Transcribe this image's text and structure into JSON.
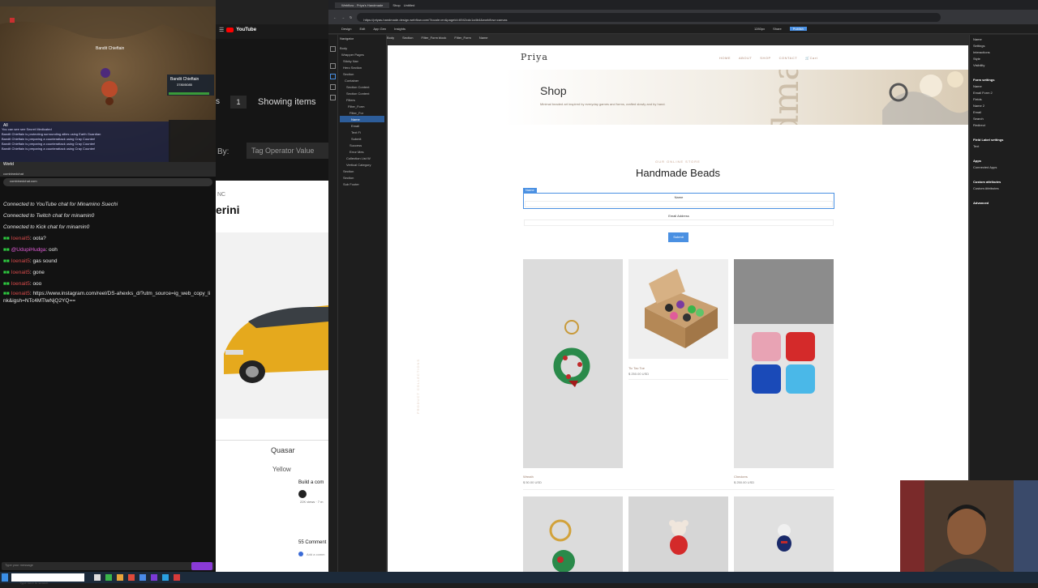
{
  "game": {
    "npc_name": "Bandit Chieftain",
    "target_name": "Bandit Chieftain",
    "target_hp": "3780/5085",
    "chat_lines": [
      "You can see see Secret Medicated",
      "Bandit Chieftain is protecting surrounding allies using Earth Guardian",
      "Bandit Chieftain is preparing a counterattack using Cray Counter!",
      "Bandit Chieftain is preparing a counterattack using Cray Counter!",
      "Bandit Chieftain is preparing a counterattack using Cray Counter!"
    ],
    "tabs": [
      "All",
      "World"
    ]
  },
  "chat": {
    "tab_label": "combinedchat",
    "address": "combinedchat.com",
    "connected": [
      "Connected to YouTube chat for Minamino Suechi",
      "Connected to Twitch chat for minamin0",
      "Connected to Kick chat for minamin0"
    ],
    "messages": [
      {
        "user": "Ioenait5",
        "text": "oota?"
      },
      {
        "user": "@UdupiHudga",
        "text": "ooh"
      },
      {
        "user": "Ioenait5",
        "text": "gas sound"
      },
      {
        "user": "Ioenait5",
        "text": "gone"
      },
      {
        "user": "Ioenait5",
        "text": "ooo"
      },
      {
        "user": "Ioenait5",
        "text": "https://www.instagram.com/reel/DS-ahexks_d/?utm_source=ig_web_copy_link&igsh=NTc4MTlwNjQ2YQ=="
      }
    ],
    "username_color": "#d44a4a",
    "input_placeholder": "Type your message"
  },
  "yt": {
    "logo": "YouTube",
    "count": "1",
    "showing": "Showing items",
    "by": "By:",
    "tag_op": "Tag Operator Value",
    "nc": "NC",
    "brand": "erini",
    "quasar": "Quasar",
    "yellow": "Yellow",
    "build": "Build a com",
    "comments": "55 Comment",
    "add": "Add a comm",
    "views": "22K views · 7 m"
  },
  "browser": {
    "tabs": [
      "Webflow - Priya's Handmade",
      "Shop",
      "Untitled"
    ],
    "url": "https://priyas-handmade.design.webflow.com/?locale=en&pageId=6942cdc1a4b4&workflow=canvas"
  },
  "webflow": {
    "topbar": {
      "design": "Design",
      "edit": "Edit",
      "app_gen": "App Gen",
      "insights": "Insights",
      "breakpoint": "1280px",
      "share": "Share",
      "publish": "Publish"
    },
    "breadcrumb": [
      "Body",
      "Section",
      "Filter_Form block",
      "Filter_Form",
      "Name"
    ],
    "navigator_title": "Navigator",
    "navigator_items": [
      "Body",
      "Wrapper Pages",
      "Sticky Nav",
      "Hero Section",
      "Section",
      "Container",
      "Section Content",
      "Section Content",
      "Filters",
      "Filter_Form",
      "Filter_For",
      "Name",
      "Email",
      "Text Fi",
      "Submit",
      "Success",
      "Error Mes",
      "Collection List W",
      "Vertical Category",
      "Section",
      "Section",
      "Sub Footer"
    ],
    "right_panel": [
      "Name",
      "Settings",
      "Interactions",
      "Style",
      "Visibility",
      "Form settings",
      "Name",
      "Email Form 2",
      "Fields",
      "Name 2",
      "Email",
      "Search",
      "Redirect",
      "Field Label settings",
      "Text",
      "Apps",
      "Connected Apps",
      "Custom attributes",
      "Custom Attributes",
      "Advanced"
    ]
  },
  "site": {
    "logo": "Priya",
    "nav": [
      "HOME",
      "ABOUT",
      "SHOP",
      "CONTACT"
    ],
    "cart": "Cart",
    "hero_title": "Shop",
    "hero_sub": "Minimal beaded art inspired by everyday games and forms, crafted slowly and by hand.",
    "section_eyebrow": "OUR ONLINE STORE",
    "section_title": "Handmade Beads",
    "selection_badge": "Name",
    "name_label": "Name",
    "email_label": "Email Address",
    "submit": "Submit",
    "side_text": "PRODUCT COLLECTIONS",
    "products": [
      {
        "name": "Wreath",
        "price": "$ 50.00 USD"
      },
      {
        "name": "Tic Tac Toe",
        "price": "$ 250.00 USD"
      },
      {
        "name": "Checkers",
        "price": "$ 250.00 USD"
      },
      {
        "name": "",
        "price": ""
      },
      {
        "name": "",
        "price": ""
      },
      {
        "name": "",
        "price": ""
      }
    ],
    "accent": "#4a90e2"
  },
  "taskbar": {
    "search": "Type here to search"
  }
}
